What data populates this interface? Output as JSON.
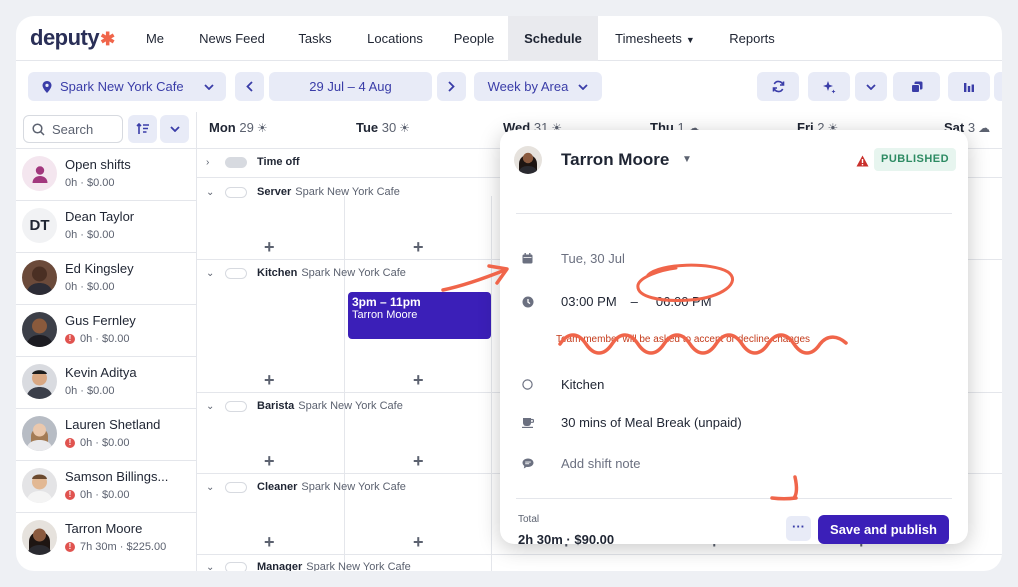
{
  "brand": {
    "name": "deputy",
    "accent": "#3b1fb8",
    "annotation_color": "#f0654a"
  },
  "nav": {
    "items": [
      "Me",
      "News Feed",
      "Tasks",
      "Locations",
      "People",
      "Schedule",
      "Timesheets",
      "Reports"
    ],
    "active": "Schedule"
  },
  "toolbar": {
    "location": "Spark New York Cafe",
    "date_range": "29 Jul – 4 Aug",
    "view": "Week by Area",
    "icons": [
      "refresh-icon",
      "sparkle-icon",
      "chevron-down-icon",
      "copy-icon",
      "chart-icon"
    ]
  },
  "search": {
    "placeholder": "Search"
  },
  "days": [
    {
      "label": "Mon",
      "num": "29",
      "icon": "sun-icon"
    },
    {
      "label": "Tue",
      "num": "30",
      "icon": "sun-icon"
    },
    {
      "label": "Wed",
      "num": "31",
      "icon": "sun-icon"
    },
    {
      "label": "Thu",
      "num": "1",
      "icon": "cloud-icon"
    },
    {
      "label": "Fri",
      "num": "2",
      "icon": "sun-icon"
    },
    {
      "label": "Sat",
      "num": "3",
      "icon": "cloud-icon"
    }
  ],
  "people": [
    {
      "name": "Open shifts",
      "meta": "0h · $0.00",
      "warn": false,
      "avatar": "open-shifts-icon"
    },
    {
      "name": "Dean Taylor",
      "meta": "0h · $0.00",
      "warn": false,
      "initials": "DT"
    },
    {
      "name": "Ed Kingsley",
      "meta": "0h · $0.00",
      "warn": false,
      "avatar": "photo"
    },
    {
      "name": "Gus Fernley",
      "meta": "0h · $0.00",
      "warn": true,
      "avatar": "photo"
    },
    {
      "name": "Kevin Aditya",
      "meta": "0h · $0.00",
      "warn": false,
      "avatar": "photo"
    },
    {
      "name": "Lauren Shetland",
      "meta": "0h · $0.00",
      "warn": true,
      "avatar": "photo"
    },
    {
      "name": "Samson Billings...",
      "meta": "0h · $0.00",
      "warn": true,
      "avatar": "photo"
    },
    {
      "name": "Tarron Moore",
      "meta": "7h 30m · $225.00",
      "warn": true,
      "avatar": "photo"
    }
  ],
  "areas": [
    {
      "name": "Time off",
      "sub": ""
    },
    {
      "name": "Server",
      "sub": "Spark New York Cafe"
    },
    {
      "name": "Kitchen",
      "sub": "Spark New York Cafe"
    },
    {
      "name": "Barista",
      "sub": "Spark New York Cafe"
    },
    {
      "name": "Cleaner",
      "sub": "Spark New York Cafe"
    },
    {
      "name": "Manager",
      "sub": "Spark New York Cafe"
    }
  ],
  "shift_block": {
    "time": "3pm – 11pm",
    "name": "Tarron Moore"
  },
  "modal": {
    "employee": "Tarron Moore",
    "status": "PUBLISHED",
    "date": "Tue, 30 Jul",
    "start": "03:00 PM",
    "dash": "–",
    "end": "06:00 PM",
    "warning": "Team member will be asked to accept or decline changes",
    "area": "Kitchen",
    "break": "30 mins of Meal Break (unpaid)",
    "note_placeholder": "Add shift note",
    "total_label": "Total",
    "total_value": "2h 30m · $90.00",
    "more_label": "···",
    "save_label": "Save and publish"
  }
}
